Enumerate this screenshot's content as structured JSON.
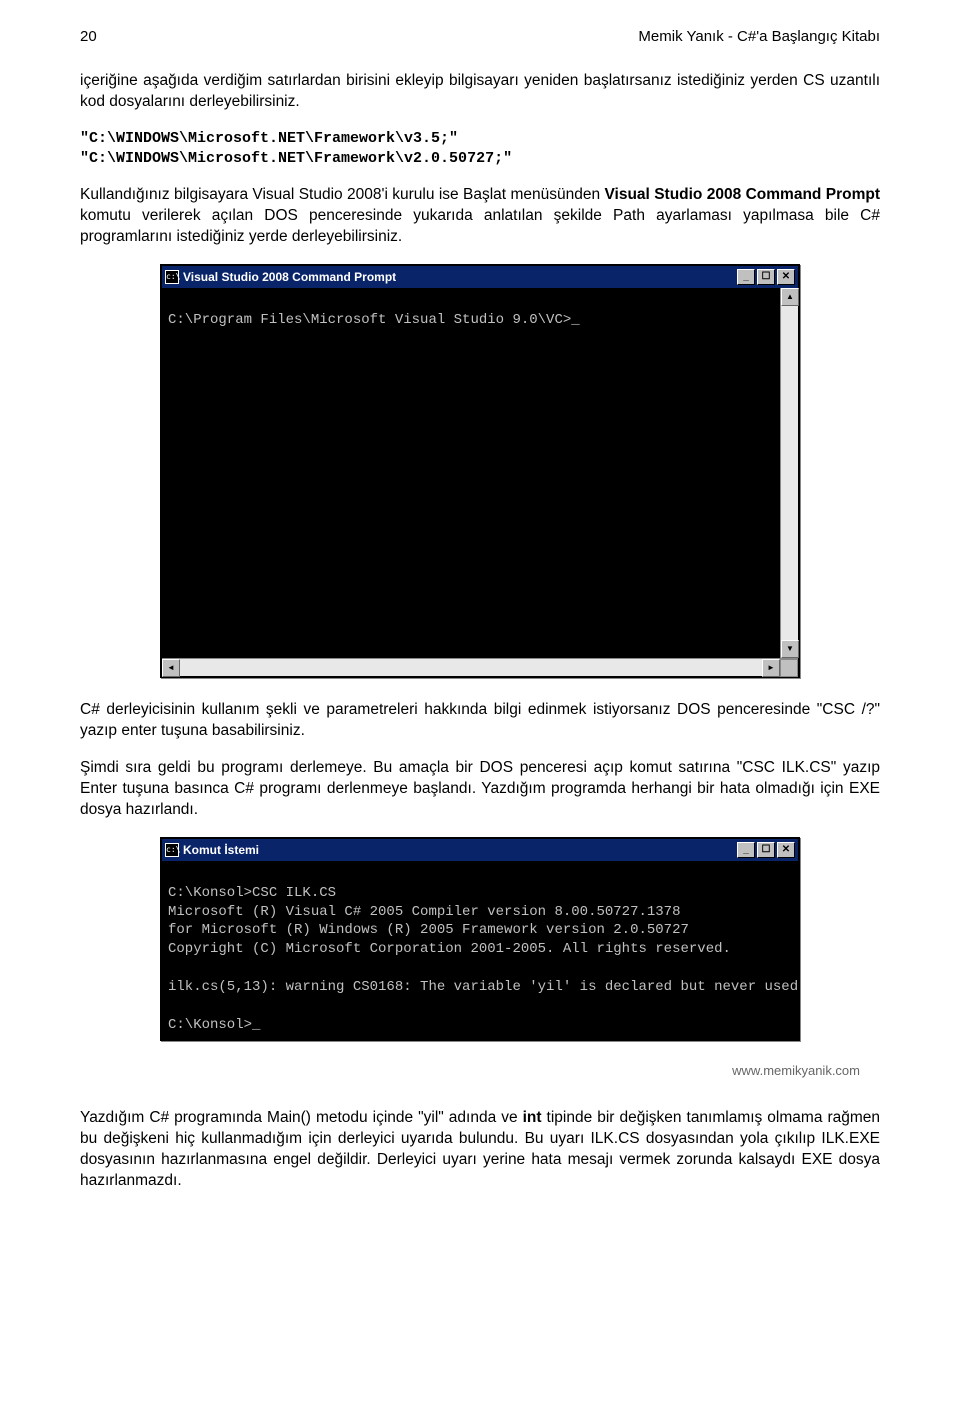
{
  "header": {
    "page_number": "20",
    "title": "Memik Yanık - C#'a Başlangıç Kitabı"
  },
  "para1": "içeriğine aşağıda verdiğim satırlardan birisini ekleyip bilgisayarı yeniden başlatırsanız istediğiniz yerden CS uzantılı kod dosyalarını derleyebilirsiniz.",
  "code1": "\"C:\\WINDOWS\\Microsoft.NET\\Framework\\v3.5;\"\n\"C:\\WINDOWS\\Microsoft.NET\\Framework\\v2.0.50727;\"",
  "para2_a": "Kullandığınız bilgisayara Visual Studio 2008'i kurulu ise Başlat menüsünden ",
  "para2_b": "Visual Studio 2008 Command Prompt",
  "para2_c": " komutu verilerek açılan DOS penceresinde yukarıda anlatılan şekilde Path ayarlaması yapılmasa bile C# programlarını istediğiniz yerde derleyebilirsiniz.",
  "terminal1": {
    "title": "Visual Studio 2008 Command Prompt",
    "body": "\nC:\\Program Files\\Microsoft Visual Studio 9.0\\VC>_"
  },
  "para3": "C# derleyicisinin kullanım şekli ve parametreleri hakkında bilgi edinmek istiyorsanız DOS penceresinde \"CSC /?\" yazıp enter tuşuna basabilirsiniz.",
  "para4": "Şimdi sıra geldi bu programı derlemeye. Bu amaçla bir DOS penceresi açıp komut satırına \"CSC ILK.CS\" yazıp Enter tuşuna basınca C# programı derlenmeye başlandı. Yazdığım programda herhangi bir hata olmadığı için EXE dosya hazırlandı.",
  "terminal2": {
    "title": "Komut İstemi",
    "body": "\nC:\\Konsol>CSC ILK.CS\nMicrosoft (R) Visual C# 2005 Compiler version 8.00.50727.1378\nfor Microsoft (R) Windows (R) 2005 Framework version 2.0.50727\nCopyright (C) Microsoft Corporation 2001-2005. All rights reserved.\n\nilk.cs(5,13): warning CS0168: The variable 'yil' is declared but never used\n\nC:\\Konsol>_"
  },
  "watermark": "www.memikyanik.com",
  "para5_a": "Yazdığım C# programında Main() metodu içinde \"yil\" adında ve ",
  "para5_b": "int",
  "para5_c": " tipinde bir değişken tanımlamış olmama rağmen bu değişkeni hiç kullanmadığım için derleyici uyarıda bulundu. Bu uyarı ILK.CS dosyasından yola çıkılıp ILK.EXE dosyasının hazırlanmasına engel değildir. Derleyici uyarı yerine hata mesajı vermek zorunda kalsaydı EXE dosya hazırlanmazdı.",
  "icons": {
    "terminal_icon": "c:\\",
    "minimize": "_",
    "maximize": "☐",
    "close": "✕",
    "left": "◄",
    "right": "►",
    "up": "▲",
    "down": "▼"
  }
}
